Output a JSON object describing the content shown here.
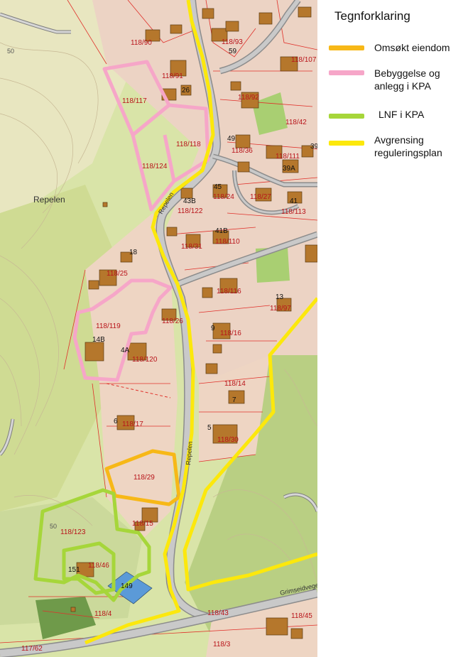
{
  "map": {
    "place_name": "Repelen",
    "road_labels": [
      "Repelen",
      "Repelen",
      "Grimseidvegen"
    ],
    "contour_labels": [
      "50",
      "50"
    ],
    "parcels": [
      "118/90",
      "118/93",
      "118/107",
      "118/91",
      "118/117",
      "118/92",
      "118/42",
      "118/118",
      "118/124",
      "118/36",
      "118/111",
      "118/27",
      "118/24",
      "118/122",
      "118/113",
      "118/110",
      "118/31",
      "118/25",
      "118/116",
      "118/97",
      "118/119",
      "118/26",
      "118/16",
      "118/120",
      "118/14",
      "118/17",
      "118/30",
      "118/29",
      "118/123",
      "118/15",
      "118/46",
      "118/4",
      "118/43",
      "118/45",
      "118/3",
      "117/62"
    ],
    "house_numbers": [
      "59",
      "26",
      "49",
      "39",
      "39A",
      "45",
      "43B",
      "41",
      "41B",
      "18",
      "13",
      "9",
      "14B",
      "4A",
      "7",
      "6",
      "5",
      "151",
      "149"
    ]
  },
  "legend": {
    "title": "Tegnforklaring",
    "items": [
      {
        "label": "Omsøkt eiendom",
        "color": "#f7b817"
      },
      {
        "label": "Bebyggelse og anlegg i KPA",
        "color": "#f6a6c8"
      },
      {
        "label": "LNF i KPA",
        "color": "#a6d63a"
      },
      {
        "label": "Avgrensing reguleringsplan",
        "color": "#fce80c"
      }
    ]
  }
}
